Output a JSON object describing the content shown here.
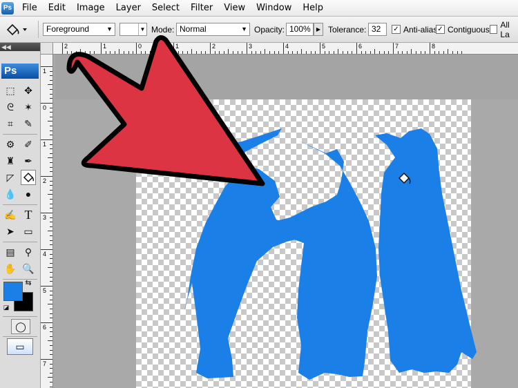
{
  "menubar": {
    "items": [
      "File",
      "Edit",
      "Image",
      "Layer",
      "Select",
      "Filter",
      "View",
      "Window",
      "Help"
    ]
  },
  "options_bar": {
    "fill_source": "Foreground",
    "mode_label": "Mode:",
    "mode_value": "Normal",
    "opacity_label": "Opacity:",
    "opacity_value": "100%",
    "tolerance_label": "Tolerance:",
    "tolerance_value": "32",
    "antialias_label": "Anti-alias",
    "antialias_checked": true,
    "contiguous_label": "Contiguous",
    "contiguous_checked": true,
    "all_layers_label": "All La",
    "all_layers_checked": false
  },
  "toolbox": {
    "badge": "Ps",
    "foreground_color": "#1a7fe6",
    "background_color": "#000000",
    "tools": [
      "marquee-icon",
      "move-icon",
      "lasso-icon",
      "magic-wand-icon",
      "crop-icon",
      "eyedropper-icon",
      "healing-icon",
      "brush-icon",
      "stamp-icon",
      "history-brush-icon",
      "eraser-icon",
      "paint-bucket-icon",
      "blur-icon",
      "dodge-icon",
      "pen-icon",
      "type-icon",
      "path-select-icon",
      "shape-icon",
      "notes-icon",
      "eyedropper2-icon",
      "hand-icon",
      "zoom-icon"
    ]
  },
  "rulers": {
    "horizontal": [
      "2",
      "1",
      "0",
      "1",
      "2",
      "3",
      "4",
      "5",
      "6",
      "7",
      "8"
    ],
    "vertical": [
      "1",
      "0",
      "1",
      "2",
      "3",
      "4",
      "5",
      "6",
      "7"
    ]
  },
  "colors": {
    "penguin_fill": "#1a7fe6",
    "arrow_fill": "#dd3444"
  }
}
